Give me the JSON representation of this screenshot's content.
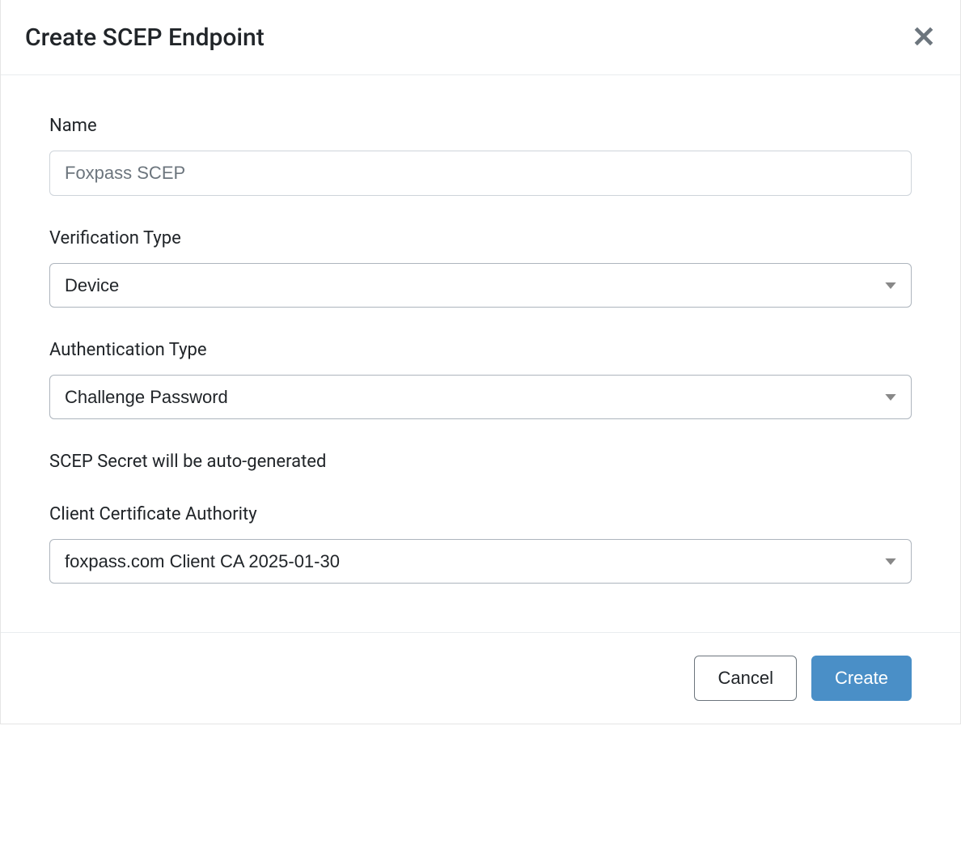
{
  "modal": {
    "title": "Create SCEP Endpoint"
  },
  "form": {
    "name": {
      "label": "Name",
      "placeholder": "Foxpass SCEP",
      "value": ""
    },
    "verification_type": {
      "label": "Verification Type",
      "value": "Device"
    },
    "authentication_type": {
      "label": "Authentication Type",
      "value": "Challenge Password"
    },
    "info_text": "SCEP Secret will be auto-generated",
    "client_ca": {
      "label": "Client Certificate Authority",
      "value": "foxpass.com Client CA 2025-01-30"
    }
  },
  "footer": {
    "cancel_label": "Cancel",
    "create_label": "Create"
  }
}
